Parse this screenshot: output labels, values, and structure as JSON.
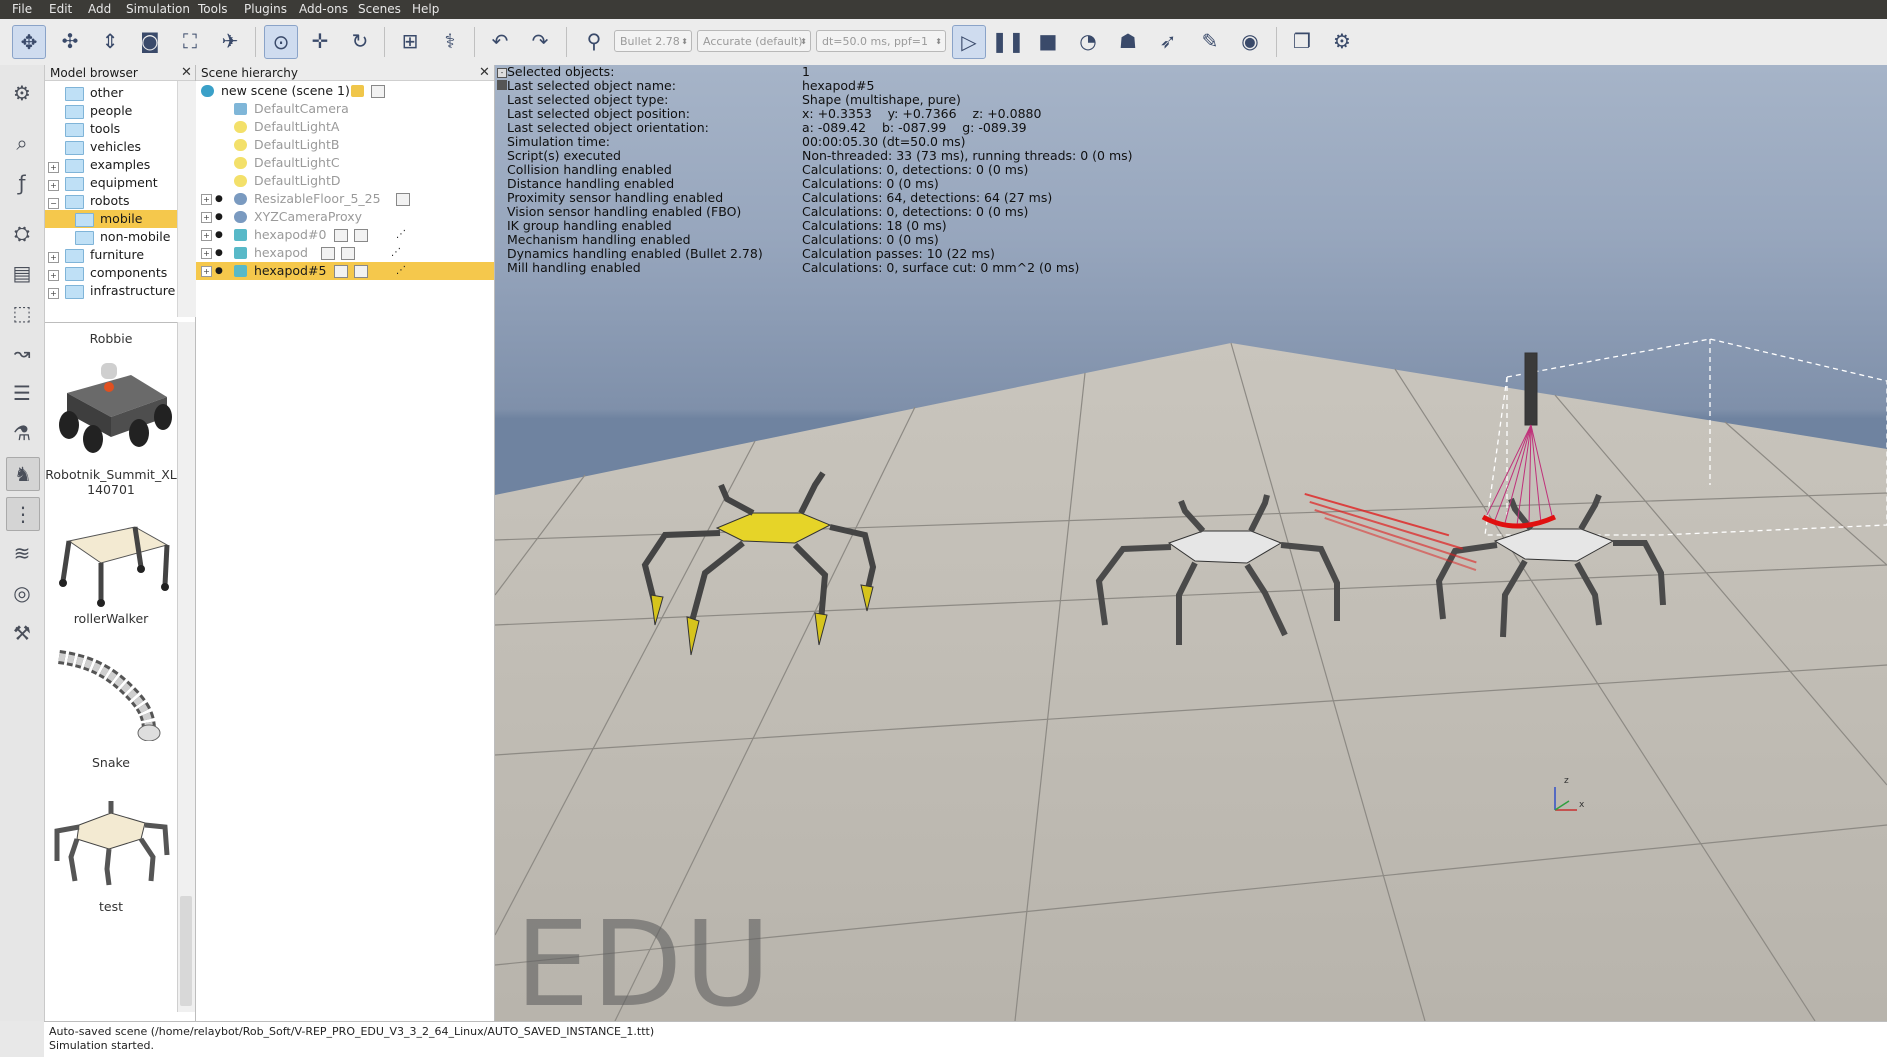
{
  "menu": [
    "File",
    "Edit",
    "Add",
    "Simulation",
    "Tools",
    "Plugins",
    "Add-ons",
    "Scenes",
    "Help"
  ],
  "toolbar": {
    "engine": "Bullet 2.78",
    "accuracy": "Accurate (default)",
    "timestep": "dt=50.0 ms, ppf=1"
  },
  "model_browser": {
    "title": "Model browser",
    "folders": [
      {
        "label": "other",
        "level": 0
      },
      {
        "label": "people",
        "level": 0
      },
      {
        "label": "tools",
        "level": 0
      },
      {
        "label": "vehicles",
        "level": 0
      },
      {
        "label": "examples",
        "level": 0,
        "expandable": true
      },
      {
        "label": "equipment",
        "level": 0,
        "expandable": true
      },
      {
        "label": "robots",
        "level": 0,
        "expanded": true
      },
      {
        "label": "mobile",
        "level": 1,
        "selected": true
      },
      {
        "label": "non-mobile",
        "level": 1
      },
      {
        "label": "furniture",
        "level": 0,
        "expandable": true
      },
      {
        "label": "components",
        "level": 0,
        "expandable": true
      },
      {
        "label": "infrastructure",
        "level": 0,
        "expandable": true
      }
    ],
    "thumbnails": [
      {
        "label": "Robbie"
      },
      {
        "label": "Robotnik_Summit_XL\n140701"
      },
      {
        "label": "rollerWalker"
      },
      {
        "label": "Snake"
      },
      {
        "label": "test"
      }
    ]
  },
  "scene_hierarchy": {
    "title": "Scene hierarchy",
    "items": [
      {
        "label": "new scene (scene 1)",
        "type": "scene",
        "level": 0
      },
      {
        "label": "DefaultCamera",
        "type": "camera",
        "level": 1,
        "grey": true
      },
      {
        "label": "DefaultLightA",
        "type": "light",
        "level": 1,
        "grey": true
      },
      {
        "label": "DefaultLightB",
        "type": "light",
        "level": 1,
        "grey": true
      },
      {
        "label": "DefaultLightC",
        "type": "light",
        "level": 1,
        "grey": true
      },
      {
        "label": "DefaultLightD",
        "type": "light",
        "level": 1,
        "grey": true
      },
      {
        "label": "ResizableFloor_5_25",
        "type": "model",
        "level": 1,
        "grey": true
      },
      {
        "label": "XYZCameraProxy",
        "type": "model",
        "level": 1,
        "grey": true
      },
      {
        "label": "hexapod#0",
        "type": "shape",
        "level": 1,
        "grey": true
      },
      {
        "label": "hexapod",
        "type": "shape",
        "level": 1,
        "grey": true
      },
      {
        "label": "hexapod#5",
        "type": "shape",
        "level": 1,
        "selected": true
      }
    ]
  },
  "info": [
    {
      "k": "Selected objects:",
      "v": "1"
    },
    {
      "k": "Last selected object name:",
      "v": "hexapod#5"
    },
    {
      "k": "Last selected object type:",
      "v": "Shape (multishape, pure)"
    },
    {
      "k": "Last selected object position:",
      "v": "x: +0.3353    y: +0.7366    z: +0.0880"
    },
    {
      "k": "Last selected object orientation:",
      "v": "a: -089.42    b: -087.99    g: -089.39"
    },
    {
      "k": "Simulation time:",
      "v": "00:00:05.30 (dt=50.0 ms)"
    },
    {
      "k": "Script(s) executed",
      "v": "Non-threaded: 33 (73 ms), running threads: 0 (0 ms)"
    },
    {
      "k": "Collision handling enabled",
      "v": "Calculations: 0, detections: 0 (0 ms)"
    },
    {
      "k": "Distance handling enabled",
      "v": "Calculations: 0 (0 ms)"
    },
    {
      "k": "Proximity sensor handling enabled",
      "v": "Calculations: 64, detections: 64 (27 ms)"
    },
    {
      "k": "Vision sensor handling enabled (FBO)",
      "v": "Calculations: 0, detections: 0 (0 ms)"
    },
    {
      "k": "IK group handling enabled",
      "v": "Calculations: 18 (0 ms)"
    },
    {
      "k": "Mechanism handling enabled",
      "v": "Calculations: 0 (0 ms)"
    },
    {
      "k": "Dynamics handling enabled (Bullet 2.78)",
      "v": "Calculation passes: 10 (22 ms)"
    },
    {
      "k": "Mill handling enabled",
      "v": "Calculations: 0, surface cut: 0 mm^2 (0 ms)"
    }
  ],
  "watermark": "EDU",
  "axis_labels": {
    "z": "z",
    "x": "x"
  },
  "status": [
    "Auto-saved scene (/home/relaybot/Rob_Soft/V-REP_PRO_EDU_V3_3_2_64_Linux/AUTO_SAVED_INSTANCE_1.ttt)",
    "Simulation started."
  ],
  "colors": {
    "selection": "#f5c84c",
    "menubar": "#3c3b37",
    "floor": "#c9c6bf"
  },
  "icons": {
    "toolbar": [
      "camera-pan-icon",
      "camera-rotate-icon",
      "camera-shift-icon",
      "camera-angle-icon",
      "fit-to-view-icon",
      "fly-icon",
      "click-select-icon",
      "object-shift-icon",
      "object-rotate-icon",
      "assemble-icon",
      "transfer-dna-icon",
      "undo-icon",
      "redo-icon",
      "dynamics-icon",
      "start-icon",
      "pause-icon",
      "stop-icon",
      "realtime-icon",
      "slow-icon",
      "fast-icon",
      "thread-icon",
      "visualization-icon",
      "page-selector-icon",
      "scene-selector-icon"
    ],
    "left": [
      "gear-icon",
      "magnifier-icon",
      "function-icon",
      "collection-icon",
      "script-icon",
      "shape-edit-icon",
      "path-icon",
      "selection-icon",
      "layer-icon",
      "model-browser-icon",
      "hierarchy-icon",
      "layers-icon",
      "camera-icon",
      "settings-icon"
    ]
  }
}
